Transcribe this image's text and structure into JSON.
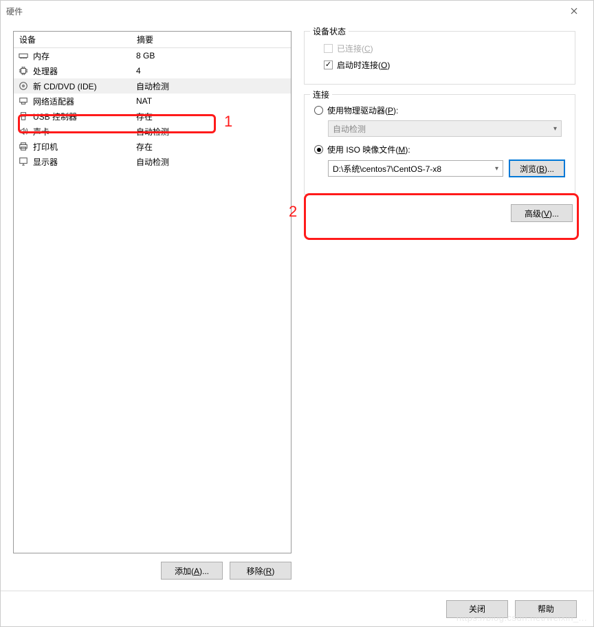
{
  "window": {
    "title": "硬件"
  },
  "columns": {
    "device": "设备",
    "summary": "摘要"
  },
  "devices": [
    {
      "name": "内存",
      "summary": "8 GB",
      "icon": "memory"
    },
    {
      "name": "处理器",
      "summary": "4",
      "icon": "cpu"
    },
    {
      "name": "新 CD/DVD (IDE)",
      "summary": "自动检测",
      "icon": "disc",
      "selected": true
    },
    {
      "name": "网络适配器",
      "summary": "NAT",
      "icon": "network"
    },
    {
      "name": "USB 控制器",
      "summary": "存在",
      "icon": "usb"
    },
    {
      "name": "声卡",
      "summary": "自动检测",
      "icon": "sound"
    },
    {
      "name": "打印机",
      "summary": "存在",
      "icon": "printer"
    },
    {
      "name": "显示器",
      "summary": "自动检测",
      "icon": "display"
    }
  ],
  "buttons": {
    "add": "添加(",
    "add_u": "A",
    "add_suffix": ")...",
    "remove": "移除(",
    "remove_u": "R",
    "remove_suffix": ")",
    "browse": "浏览(",
    "browse_u": "B",
    "browse_suffix": ")...",
    "advanced": "高级(",
    "advanced_u": "V",
    "advanced_suffix": ")...",
    "close": "关闭",
    "help": "帮助"
  },
  "status": {
    "legend": "设备状态",
    "connected": "已连接(",
    "connected_u": "C",
    "connected_suffix": ")",
    "connect_poweron": "启动时连接(",
    "connect_poweron_u": "O",
    "connect_poweron_suffix": ")"
  },
  "connection": {
    "legend": "连接",
    "physical": "使用物理驱动器(",
    "physical_u": "P",
    "physical_suffix": "):",
    "physical_value": "自动检测",
    "iso": "使用 ISO 映像文件(",
    "iso_u": "M",
    "iso_suffix": "):",
    "iso_value": "D:\\系统\\centos7\\CentOS-7-x8"
  },
  "annotations": {
    "one": "1",
    "two": "2"
  },
  "watermark": "https://blog.csdn.net/weixin_..."
}
